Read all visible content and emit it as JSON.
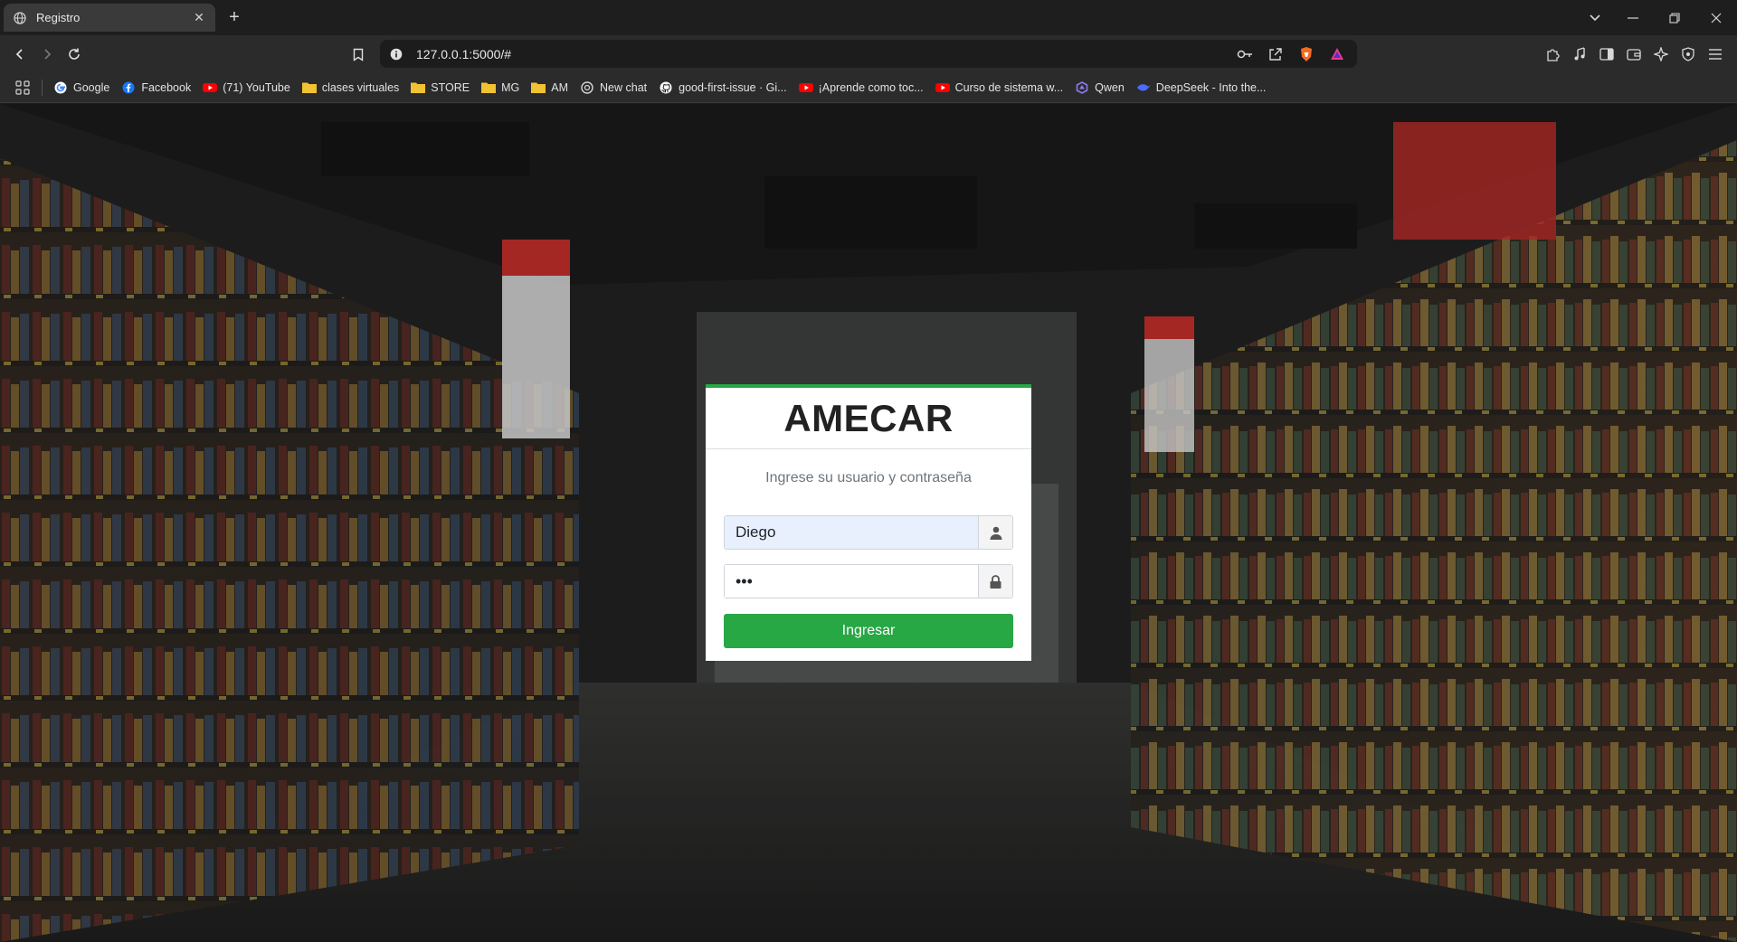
{
  "browser": {
    "tab": {
      "title": "Registro"
    },
    "url": "127.0.0.1:5000/#",
    "bookmarks": [
      {
        "label": "Google",
        "icon": "google-icon"
      },
      {
        "label": "Facebook",
        "icon": "facebook-icon"
      },
      {
        "label": "(71) YouTube",
        "icon": "youtube-icon"
      },
      {
        "label": "clases virtuales",
        "icon": "folder-icon"
      },
      {
        "label": "STORE",
        "icon": "folder-icon"
      },
      {
        "label": "MG",
        "icon": "folder-icon"
      },
      {
        "label": "AM",
        "icon": "folder-icon"
      },
      {
        "label": "New chat",
        "icon": "chat-icon"
      },
      {
        "label": "good-first-issue · Gi...",
        "icon": "github-icon"
      },
      {
        "label": "¡Aprende como toc...",
        "icon": "youtube-icon"
      },
      {
        "label": "Curso de sistema w...",
        "icon": "youtube-icon"
      },
      {
        "label": "Qwen",
        "icon": "qwen-icon"
      },
      {
        "label": "DeepSeek - Into the...",
        "icon": "deepseek-icon"
      }
    ]
  },
  "login": {
    "title": "AMECAR",
    "message": "Ingrese su usuario y contraseña",
    "username_value": "Diego",
    "password_value": "•••",
    "submit_label": "Ingresar"
  },
  "colors": {
    "accent": "#28a745",
    "autofill": "#e8f0fe"
  }
}
